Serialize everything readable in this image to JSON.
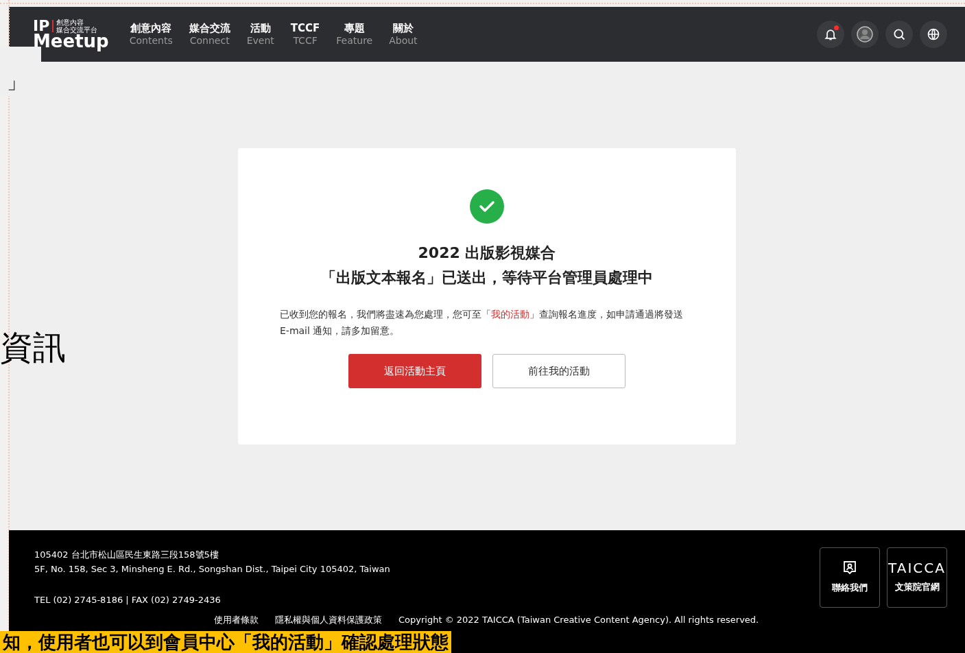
{
  "header": {
    "logo": {
      "mark": "IP",
      "tagline": [
        "創意內容",
        "媒合交流平台"
      ],
      "name": "Meetup"
    },
    "nav": [
      {
        "label": "創意內容",
        "sublabel": "Contents"
      },
      {
        "label": "媒合交流",
        "sublabel": "Connect"
      },
      {
        "label": "活動",
        "sublabel": "Event"
      },
      {
        "label": "TCCF",
        "sublabel": "TCCF"
      },
      {
        "label": "專題",
        "sublabel": "Feature"
      },
      {
        "label": "關於",
        "sublabel": "About"
      }
    ],
    "notifications": {
      "unread": true
    }
  },
  "card": {
    "title_lines": [
      "2022 出版影視媒合",
      "「出版文本報名」已送出，等待平台管理員處理中"
    ],
    "message": {
      "before": "已收到您的報名，我們將盡速為您處理，您可至「",
      "link": "我的活動",
      "after": "」查詢報名進度，如申請通過將發送 E-mail 通知，請多加留意。"
    },
    "buttons": [
      {
        "label": "返回活動主頁",
        "kind": "primary"
      },
      {
        "label": "前往我的活動",
        "kind": "secondary"
      }
    ]
  },
  "footer": {
    "address_zh": "105402 台北市松山區民生東路三段158號5樓",
    "address_en": "5F, No. 158, Sec 3, Minsheng E. Rd., Songshan Dist., Taipei City 105402, Taiwan",
    "contact": "TEL (02) 2745-8186 | FAX (02) 2749-2436",
    "links": [
      "使用者條款",
      "隱私權與個人資料保護政策"
    ],
    "copyright": "Copyright © 2022 TAICCA (Taiwan Creative Content Agency). All rights reserved.",
    "tiles": [
      {
        "kind": "contact",
        "label": "聯絡我們"
      },
      {
        "kind": "logo",
        "logo": "TAICCA",
        "label": "文策院官網"
      }
    ]
  },
  "overlay": {
    "fragments": [
      "」",
      "資訊"
    ],
    "caption": "知，使用者也可以到會員中心「我的活動」確認處理狀態"
  }
}
